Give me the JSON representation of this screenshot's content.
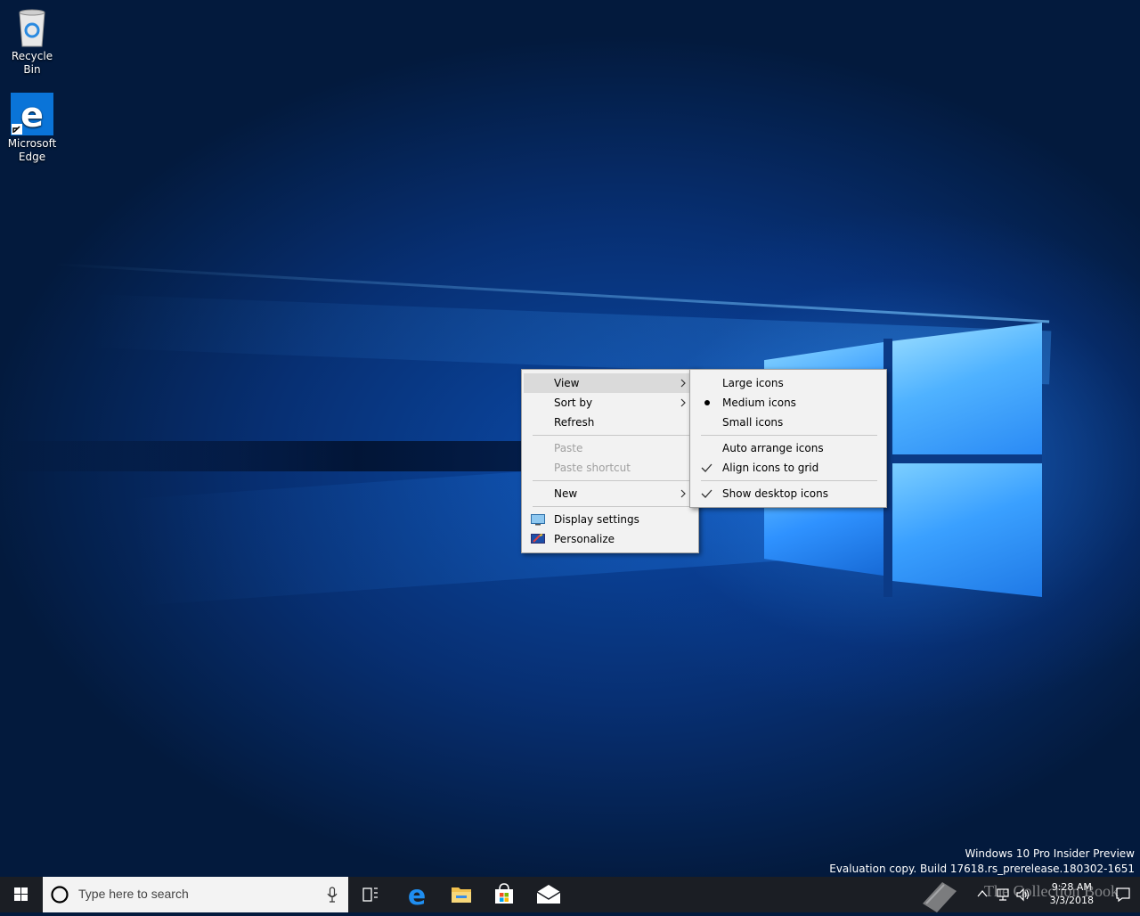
{
  "desktop_icons": [
    {
      "label": "Recycle Bin",
      "icon": "recycle-bin-icon"
    },
    {
      "label": "Microsoft Edge",
      "icon": "edge-icon"
    }
  ],
  "context_menu": {
    "items": [
      {
        "label": "View",
        "has_submenu": true,
        "highlighted": true
      },
      {
        "label": "Sort by",
        "has_submenu": true
      },
      {
        "label": "Refresh"
      },
      {
        "label": "Paste",
        "disabled": true
      },
      {
        "label": "Paste shortcut",
        "disabled": true
      },
      {
        "label": "New",
        "has_submenu": true
      },
      {
        "label": "Display settings",
        "icon": "display-settings-icon"
      },
      {
        "label": "Personalize",
        "icon": "personalize-icon"
      }
    ]
  },
  "view_submenu": {
    "items": [
      {
        "label": "Large icons"
      },
      {
        "label": "Medium icons",
        "mark": "bullet"
      },
      {
        "label": "Small icons"
      },
      {
        "label": "Auto arrange icons"
      },
      {
        "label": "Align icons to grid",
        "mark": "check"
      },
      {
        "label": "Show desktop icons",
        "mark": "check"
      }
    ]
  },
  "watermark": {
    "line1": "Windows 10 Pro Insider Preview",
    "line2": "Evaluation copy. Build 17618.rs_prerelease.180302-1651"
  },
  "taskbar": {
    "search_placeholder": "Type here to search",
    "pinned": [
      "task-view-icon",
      "edge-icon",
      "file-explorer-icon",
      "store-icon",
      "mail-icon"
    ],
    "clock_time": "9:28 AM",
    "clock_date": "3/3/2018",
    "site_watermark": "The Collection Book"
  },
  "colors": {
    "menu_bg": "#f2f2f2",
    "menu_highlight": "#dadada",
    "taskbar_bg": "#1b1e24",
    "accent": "#0078d7"
  }
}
